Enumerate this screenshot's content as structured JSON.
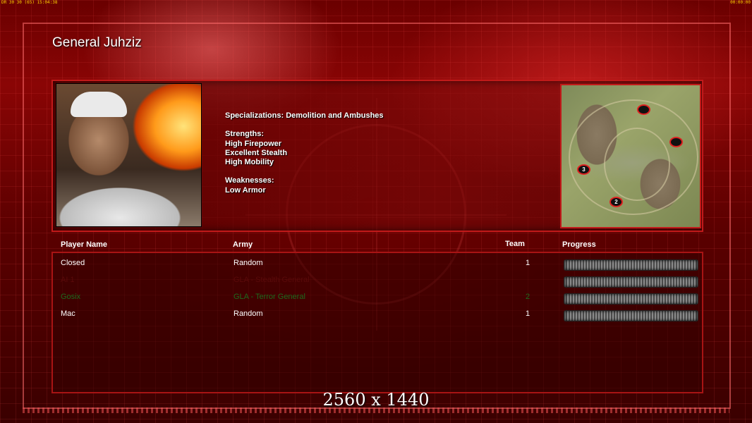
{
  "hud": {
    "left": "DR 30 30 (65) 15:04:38",
    "right": "00:00:00"
  },
  "general": {
    "title": "General Juhziz",
    "specializations": "Specializations: Demolition and Ambushes",
    "strengths_label": "Strengths:",
    "strengths": [
      "High Firepower",
      "Excellent Stealth",
      "High Mobility"
    ],
    "weaknesses_label": "Weaknesses:",
    "weaknesses": [
      "Low Armor"
    ]
  },
  "map": {
    "markers": [
      "3",
      "2"
    ]
  },
  "table": {
    "headers": {
      "player": "Player Name",
      "army": "Army",
      "team": "Team",
      "progress": "Progress"
    },
    "rows": [
      {
        "player": "Closed",
        "army": "Random",
        "team": "1",
        "color": "#ffffff"
      },
      {
        "player": "AI 1",
        "army": "GLA - Stealth General",
        "team": "",
        "color": "#5a0a0a"
      },
      {
        "player": "Gosix",
        "army": "GLA - Terror General",
        "team": "2",
        "color": "#1d6a1d"
      },
      {
        "player": "Mac",
        "army": "Random",
        "team": "1",
        "color": "#ffffff"
      }
    ]
  },
  "footer": {
    "resolution": "2560 x 1440"
  },
  "colors": {
    "accent": "#c21a1a",
    "background": "#5a0000"
  }
}
